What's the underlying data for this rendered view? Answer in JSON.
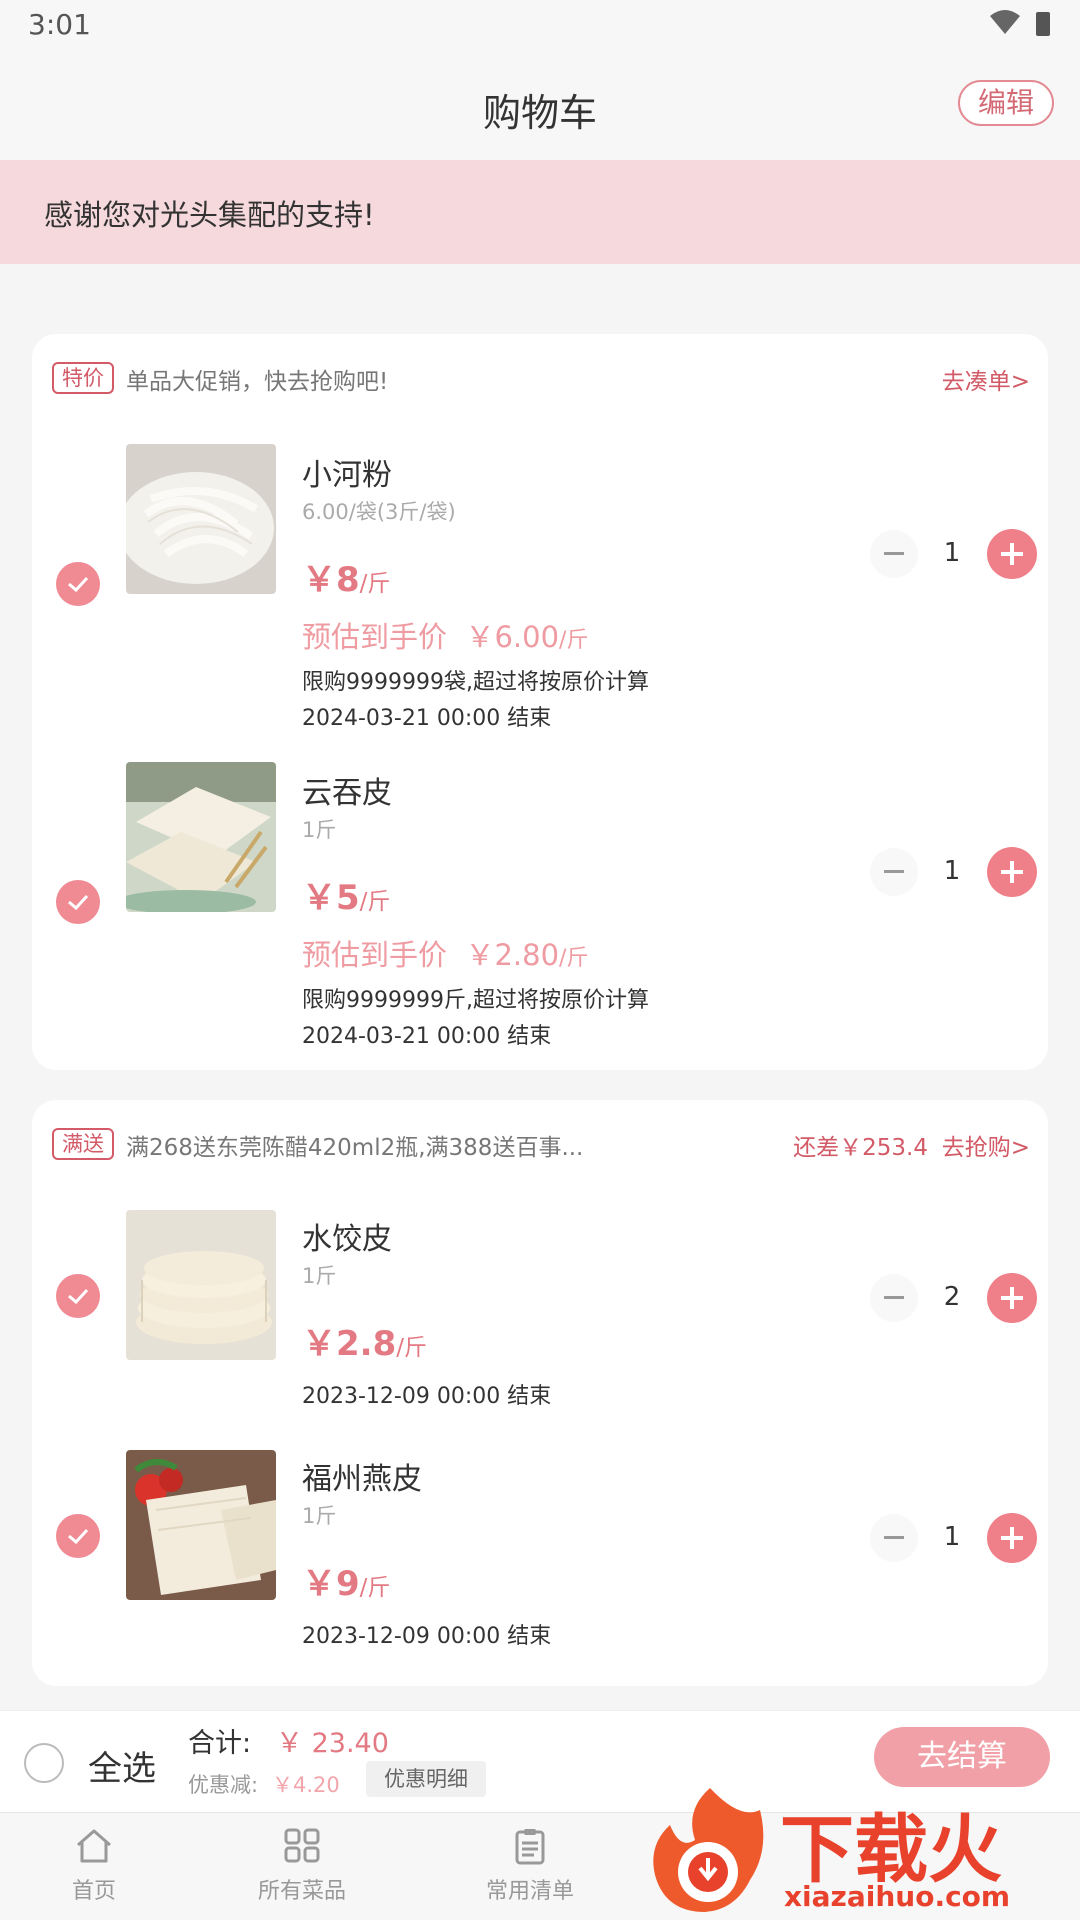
{
  "status_bar": {
    "time": "3:01"
  },
  "header": {
    "title": "购物车",
    "edit_label": "编辑"
  },
  "banner": {
    "text": "感谢您对光头集配的支持!"
  },
  "groups": [
    {
      "tag": "特价",
      "description": "单品大促销，快去抢购吧!",
      "link": "去凑单>",
      "items": [
        {
          "name": "小河粉",
          "spec": "6.00/袋(3斤/袋)",
          "price": "￥8",
          "price_unit": "/斤",
          "estimate_label": "预估到手价",
          "estimate_price": "￥6.00",
          "estimate_unit": "/斤",
          "limit": "限购9999999袋,超过将按原价计算",
          "end_time": "2024-03-21 00:00 结束",
          "quantity": "1",
          "checked": true
        },
        {
          "name": "云吞皮",
          "spec": "1斤",
          "price": "￥5",
          "price_unit": "/斤",
          "estimate_label": "预估到手价",
          "estimate_price": "￥2.80",
          "estimate_unit": "/斤",
          "limit": "限购9999999斤,超过将按原价计算",
          "end_time": "2024-03-21 00:00 结束",
          "quantity": "1",
          "checked": true
        }
      ]
    },
    {
      "tag": "满送",
      "description": "满268送东莞陈醋420ml2瓶,满388送百事...",
      "gap": "还差￥253.4",
      "link": "去抢购>",
      "items": [
        {
          "name": "水饺皮",
          "spec": "1斤",
          "price": "￥2.8",
          "price_unit": "/斤",
          "end_time": "2023-12-09 00:00 结束",
          "quantity": "2",
          "checked": true
        },
        {
          "name": "福州燕皮",
          "spec": "1斤",
          "price": "￥9",
          "price_unit": "/斤",
          "end_time": "2023-12-09 00:00 结束",
          "quantity": "1",
          "checked": true
        }
      ]
    }
  ],
  "checkout": {
    "select_all_label": "全选",
    "total_label": "合计:",
    "total_value": "￥ 23.40",
    "discount_label": "优惠减:",
    "discount_value": "￥4.20",
    "discount_detail_label": "优惠明细",
    "checkout_label": "去结算"
  },
  "tabs": [
    {
      "label": "首页",
      "icon": "home-icon"
    },
    {
      "label": "所有菜品",
      "icon": "grid-icon"
    },
    {
      "label": "常用清单",
      "icon": "clipboard-icon"
    }
  ],
  "watermark": {
    "text": "下载火",
    "domain": "xiazaihuo.com"
  },
  "colors": {
    "accent": "#ef7f88",
    "banner": "#f5d9dd",
    "promo": "#d35a67"
  }
}
